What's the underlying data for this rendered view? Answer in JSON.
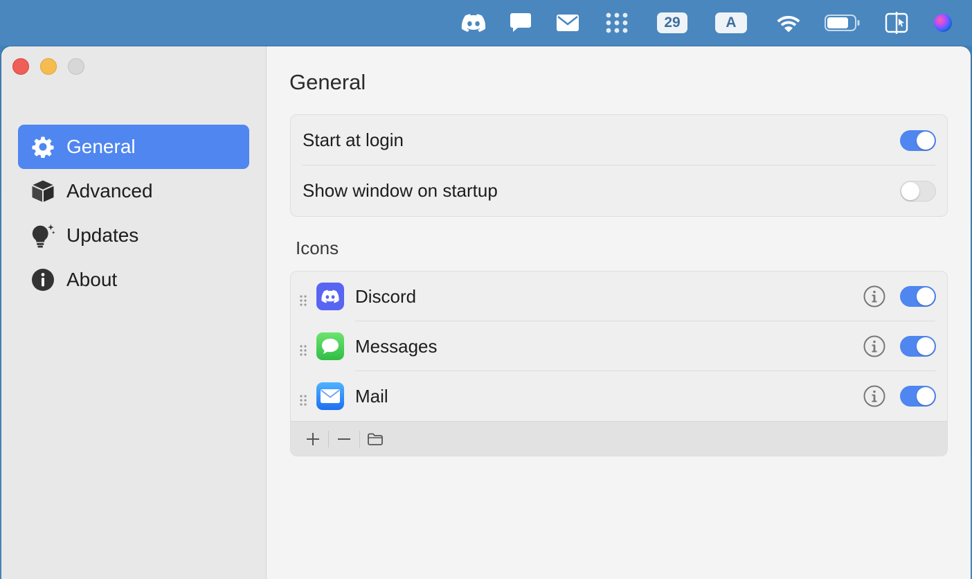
{
  "menubar": {
    "items": [
      {
        "name": "discord-menu-icon"
      },
      {
        "name": "messages-menu-icon"
      },
      {
        "name": "mail-menu-icon"
      },
      {
        "name": "grid-menu-icon"
      },
      {
        "name": "calendar-badge",
        "text": "29"
      },
      {
        "name": "input-source-badge",
        "text": "A"
      },
      {
        "name": "wifi-icon"
      },
      {
        "name": "battery-icon"
      },
      {
        "name": "screen-share-icon"
      },
      {
        "name": "siri-icon"
      }
    ],
    "calendar_day": "29",
    "input_source": "A"
  },
  "sidebar": {
    "items": [
      {
        "label": "General",
        "icon": "gear-icon",
        "active": true
      },
      {
        "label": "Advanced",
        "icon": "cube-icon",
        "active": false
      },
      {
        "label": "Updates",
        "icon": "lightbulb-sparkle-icon",
        "active": false
      },
      {
        "label": "About",
        "icon": "info-circle-icon",
        "active": false
      }
    ]
  },
  "main": {
    "title": "General",
    "settings": [
      {
        "label": "Start at login",
        "enabled": true
      },
      {
        "label": "Show window on startup",
        "enabled": false
      }
    ],
    "icons_section_label": "Icons",
    "apps": [
      {
        "name": "Discord",
        "icon": "discord-app-icon",
        "enabled": true
      },
      {
        "name": "Messages",
        "icon": "messages-app-icon",
        "enabled": true
      },
      {
        "name": "Mail",
        "icon": "mail-app-icon",
        "enabled": true
      }
    ],
    "toolbar": {
      "add": "plus-icon",
      "remove": "minus-icon",
      "folder": "folder-icon"
    }
  },
  "colors": {
    "accent": "#4f86f0",
    "close": "#ee5f57",
    "minimize": "#f5bd4f",
    "maximize": "#d7d7d7",
    "discord": "#5865f2",
    "messages": "#34c759",
    "mail": "#2f7cf6"
  }
}
